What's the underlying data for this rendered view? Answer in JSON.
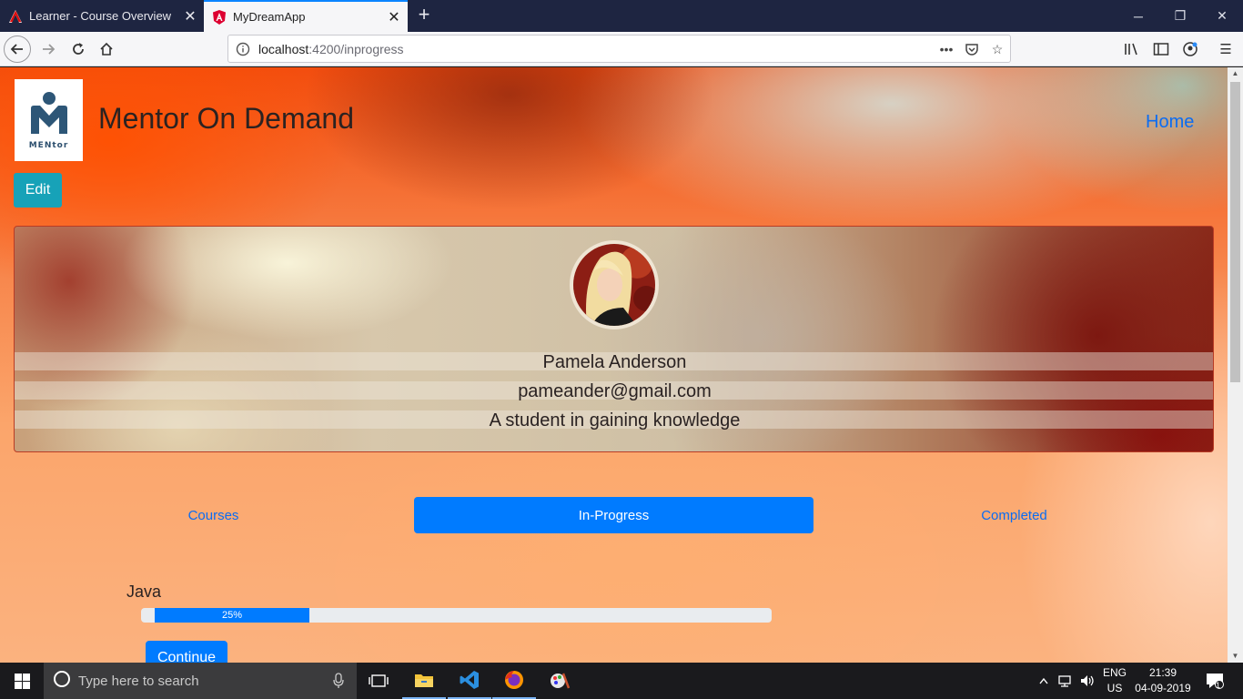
{
  "browser": {
    "tabs": [
      {
        "title": "Learner - Course Overview",
        "favicon": "angular-red-icon"
      },
      {
        "title": "MyDreamApp",
        "favicon": "angular-icon"
      }
    ],
    "url_host": "localhost",
    "url_path": ":4200/inprogress"
  },
  "page": {
    "logo_text": "MENtor",
    "brand": "Mentor On Demand",
    "nav_home": "Home",
    "edit_label": "Edit",
    "profile": {
      "name": "Pamela Anderson",
      "email": "pameander@gmail.com",
      "bio": "A student in gaining knowledge"
    },
    "tabs": {
      "courses": "Courses",
      "in_progress": "In-Progress",
      "completed": "Completed"
    },
    "course": {
      "name": "Java",
      "progress_label": "25%",
      "progress_value": 0.25,
      "continue_label": "Continue"
    }
  },
  "taskbar": {
    "search_placeholder": "Type here to search",
    "lang_top": "ENG",
    "lang_bottom": "US",
    "time": "21:39",
    "date": "04-09-2019",
    "notif_count": "1"
  },
  "colors": {
    "primary": "#007bff",
    "info": "#17a2b8",
    "link": "#0a6cf2"
  }
}
